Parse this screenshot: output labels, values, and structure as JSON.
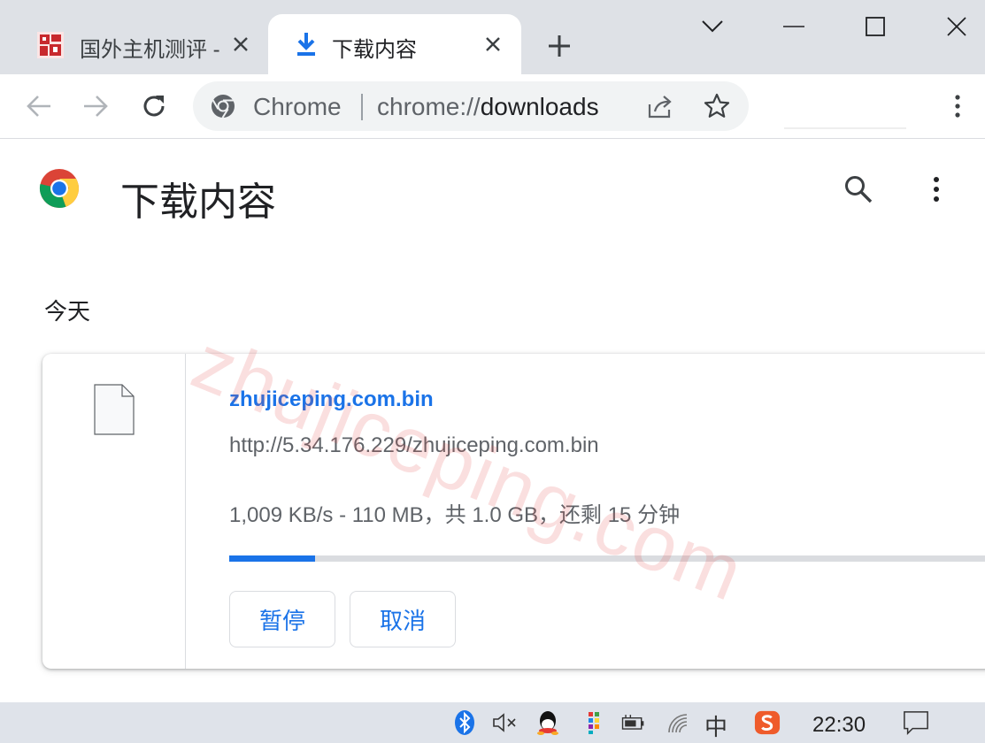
{
  "tabs": [
    {
      "title": "国外主机测评 - ",
      "favicon": "site-logo-icon",
      "close": "close-icon"
    },
    {
      "title": "下载内容",
      "favicon": "download-icon",
      "close": "close-icon"
    }
  ],
  "toolbar": {
    "scheme_label": "Chrome",
    "url_prefix": "chrome://",
    "url_host": "downloads"
  },
  "page": {
    "title": "下载内容",
    "section_date": "今天",
    "watermark": "zhujiceping.com"
  },
  "download": {
    "file_name": "zhujiceping.com.bin",
    "url": "http://5.34.176.229/zhujiceping.com.bin",
    "status": "1,009 KB/s - 110 MB，共 1.0 GB，还剩 15 分钟",
    "progress": 0.11,
    "pause_label": "暂停",
    "cancel_label": "取消"
  },
  "taskbar": {
    "ime": "中",
    "clock": "22:30"
  },
  "colors": {
    "accent": "#1a73e8",
    "tabstrip": "#dee1e6",
    "omnibox": "#f1f3f4",
    "taskbar": "#dfe3ea"
  }
}
